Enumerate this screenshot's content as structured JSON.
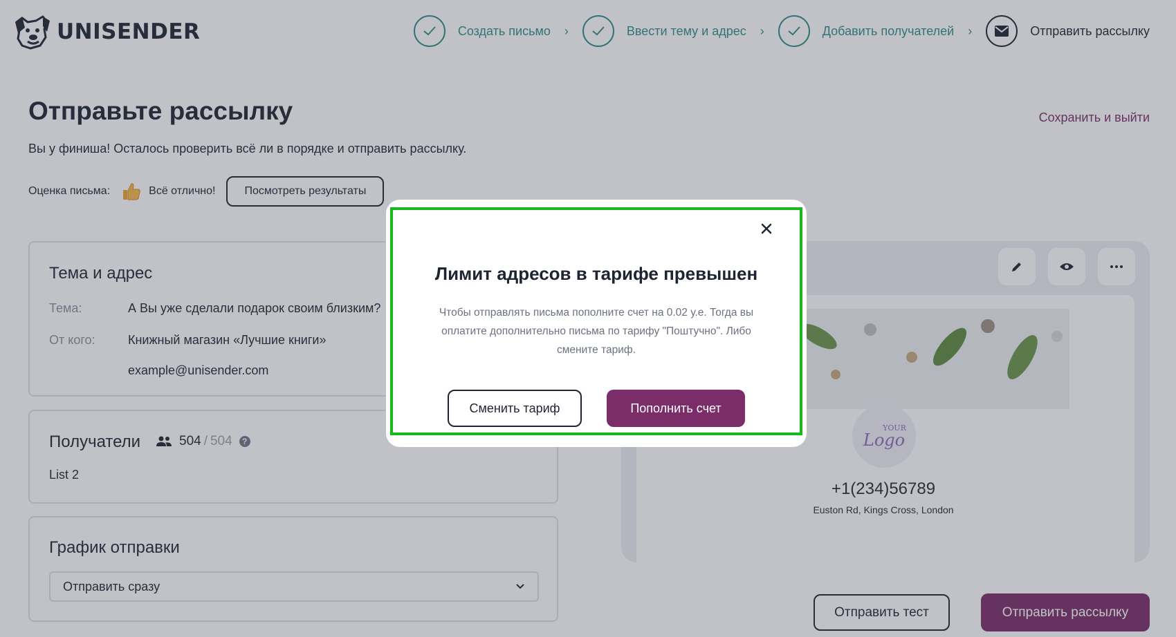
{
  "app": {
    "brand": "UNISENDER"
  },
  "steps": [
    {
      "label": "Создать письмо",
      "state": "done"
    },
    {
      "label": "Ввести тему и адрес",
      "state": "done"
    },
    {
      "label": "Добавить получателей",
      "state": "done"
    },
    {
      "label": "Отправить рассылку",
      "state": "active"
    }
  ],
  "page": {
    "title": "Отправьте рассылку",
    "subtitle": "Вы у финиша! Осталось проверить всё ли в порядке и отправить рассылку.",
    "save_exit": "Сохранить и выйти",
    "rating_label": "Оценка письма:",
    "rating_value": "Всё отлично!",
    "results_button": "Посмотреть результаты"
  },
  "subject_card": {
    "title": "Тема и адрес",
    "subject_label": "Тема:",
    "subject_value": "А Вы уже сделали подарок своим близким?",
    "from_label": "От кого:",
    "from_name": "Книжный магазин «Лучшие книги»",
    "from_email": "example@unisender.com"
  },
  "recipients_card": {
    "title": "Получатели",
    "count": "504",
    "separator": "/",
    "total": "504",
    "list_name": "List 2"
  },
  "schedule_card": {
    "title": "График отправки",
    "selected": "Отправить сразу"
  },
  "preview": {
    "logo_small": "YOUR",
    "logo_big": "Logo",
    "phone": "+1(234)56789",
    "address": "Euston Rd, Kings Cross, London"
  },
  "actions": {
    "test": "Отправить тест",
    "send": "Отправить рассылку"
  },
  "modal": {
    "title": "Лимит адресов в тарифе превышен",
    "text": "Чтобы отправлять письма пополните счет на 0.02 у.е. Тогда вы оплатите дополнительно письма по тарифу \"Поштучно\". Либо смените тариф.",
    "change_button": "Сменить тариф",
    "topup_button": "Пополнить счет"
  },
  "colors": {
    "brand": "#7b2d69",
    "step_done": "#2f8c87",
    "highlight": "#19b81d",
    "text": "#1f2433"
  }
}
